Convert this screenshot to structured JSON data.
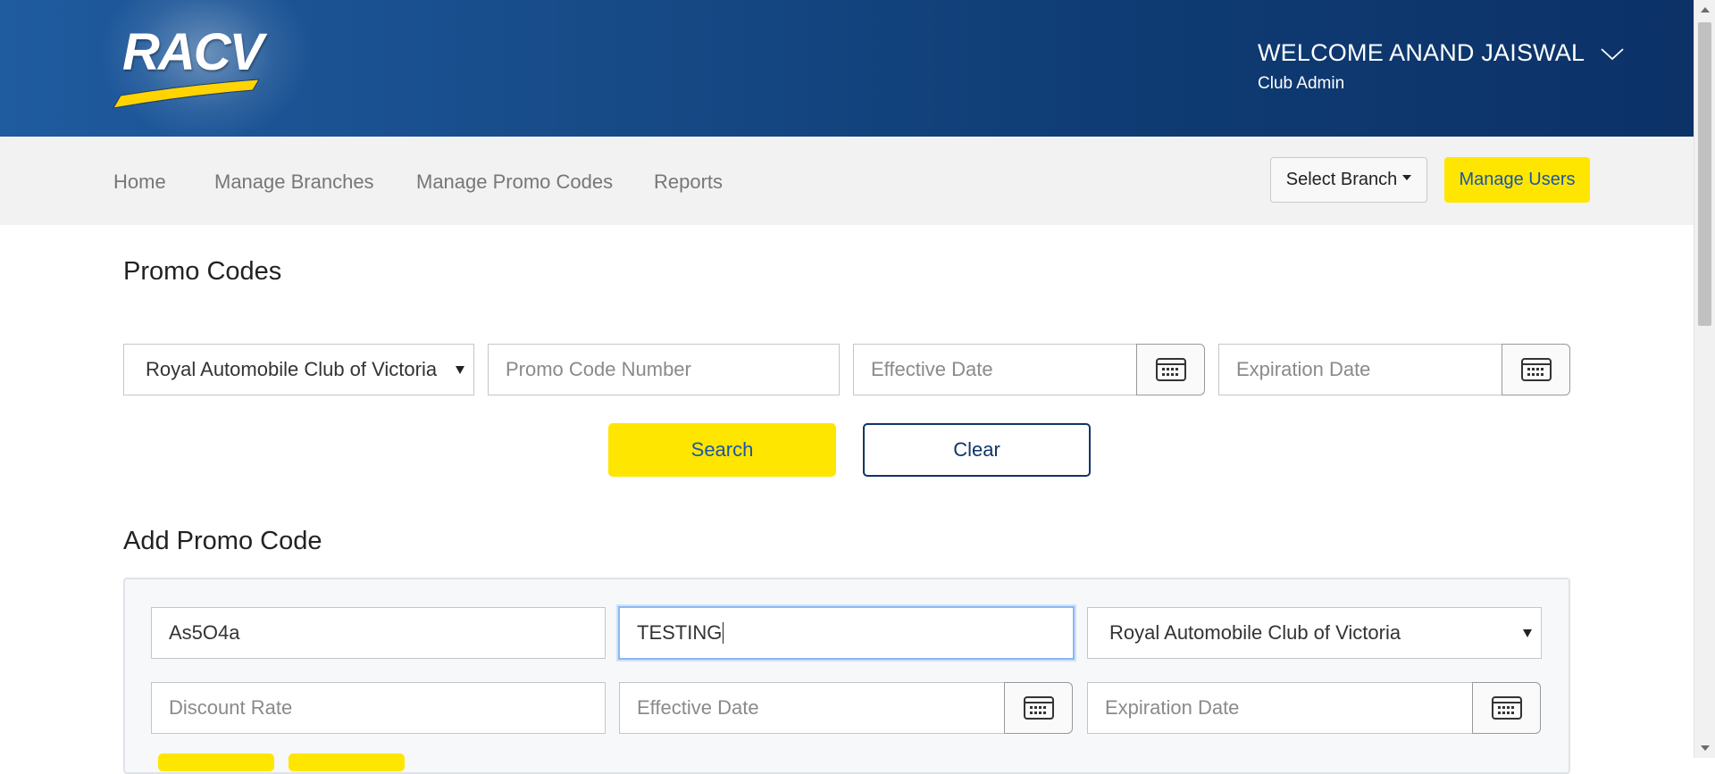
{
  "header": {
    "logo_text": "RACV",
    "welcome": "WELCOME ANAND JAISWAL",
    "role": "Club Admin"
  },
  "nav": {
    "items": [
      "Home",
      "Manage Branches",
      "Manage Promo Codes",
      "Reports"
    ],
    "select_branch": "Select Branch",
    "manage_users": "Manage Users"
  },
  "promo_codes": {
    "title": "Promo Codes",
    "club_select": "Royal Automobile Club of Victoria",
    "promo_number_placeholder": "Promo Code Number",
    "effective_date_placeholder": "Effective Date",
    "expiration_date_placeholder": "Expiration Date",
    "search_label": "Search",
    "clear_label": "Clear"
  },
  "add_promo": {
    "title": "Add Promo Code",
    "code_value": "As5O4a",
    "description_value": "TESTING",
    "club_select": "Royal Automobile Club of Victoria",
    "discount_placeholder": "Discount Rate",
    "effective_date_placeholder": "Effective Date",
    "expiration_date_placeholder": "Expiration Date"
  },
  "colors": {
    "header_blue": "#0f3c74",
    "accent_yellow": "#ffe600",
    "link_blue": "#1a56a8"
  }
}
